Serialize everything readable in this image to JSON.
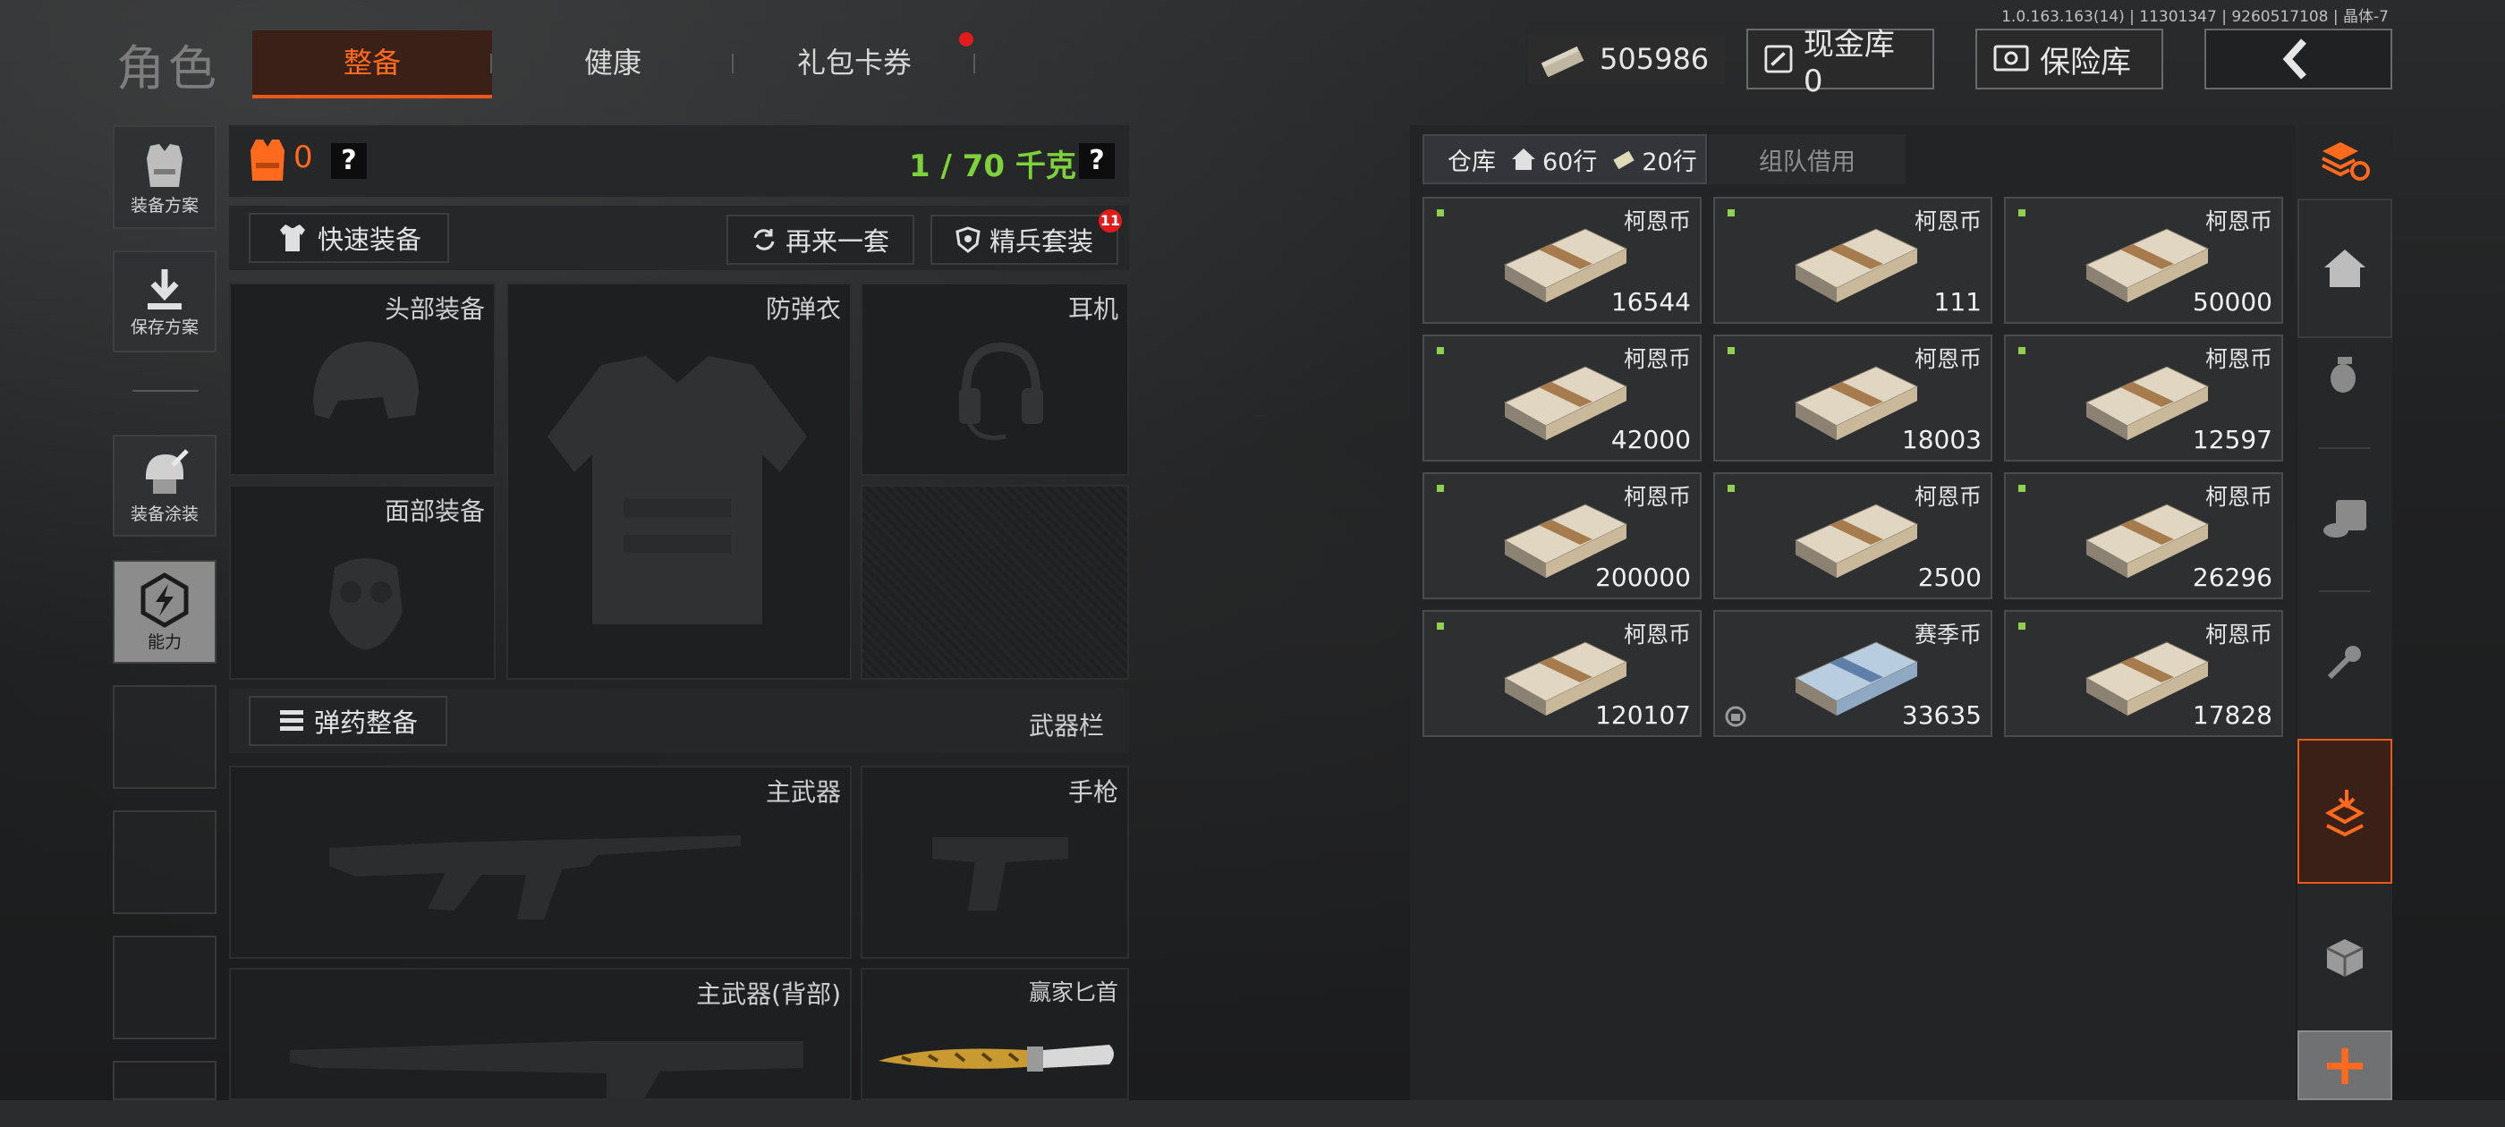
{
  "version": "1.0.163.163(14) | 11301347 | 9260517108 | 晶体-7",
  "header": {
    "title": "角色",
    "tabs": [
      {
        "label": "整备",
        "active": true
      },
      {
        "label": "健康",
        "active": false
      },
      {
        "label": "礼包卡券",
        "active": false,
        "badge_dot": true
      }
    ],
    "money": "505986",
    "cash_vault": "现金库 0",
    "safe_box": "保险库"
  },
  "left_tools": [
    {
      "label": "装备方案",
      "icon": "vest-plan-icon"
    },
    {
      "label": "保存方案",
      "icon": "download-icon"
    },
    {
      "label": "装备涂装",
      "icon": "helmet-paint-icon"
    },
    {
      "label": "能力",
      "icon": "lightning-icon",
      "active": true
    }
  ],
  "gear": {
    "armor_count": "0",
    "weight": "1 / 70 千克",
    "question": "?",
    "quick_equip": "快速装备",
    "another_set": "再来一套",
    "elite_set": "精兵套装",
    "elite_badge": "11",
    "slots": {
      "head": "头部装备",
      "vest": "防弹衣",
      "headset": "耳机",
      "face": "面部装备",
      "primary": "主武器",
      "pistol": "手枪",
      "primary_back": "主武器(背部)",
      "knife": "赢家匕首"
    },
    "ammo_btn": "弹药整备",
    "weapon_bar": "武器栏"
  },
  "warehouse": {
    "tab_label": "仓库",
    "rows_home": "60行",
    "rows_ticket": "20行",
    "team_borrow": "组队借用",
    "items": [
      {
        "name": "柯恩币",
        "qty": "16544",
        "kind": "koen"
      },
      {
        "name": "柯恩币",
        "qty": "111",
        "kind": "koen"
      },
      {
        "name": "柯恩币",
        "qty": "50000",
        "kind": "koen"
      },
      {
        "name": "柯恩币",
        "qty": "42000",
        "kind": "koen"
      },
      {
        "name": "柯恩币",
        "qty": "18003",
        "kind": "koen"
      },
      {
        "name": "柯恩币",
        "qty": "12597",
        "kind": "koen"
      },
      {
        "name": "柯恩币",
        "qty": "200000",
        "kind": "koen"
      },
      {
        "name": "柯恩币",
        "qty": "2500",
        "kind": "koen"
      },
      {
        "name": "柯恩币",
        "qty": "26296",
        "kind": "koen"
      },
      {
        "name": "柯恩币",
        "qty": "120107",
        "kind": "koen"
      },
      {
        "name": "赛季币",
        "qty": "33635",
        "kind": "season"
      },
      {
        "name": "柯恩币",
        "qty": "17828",
        "kind": "koen"
      }
    ]
  },
  "right_rail": {
    "add": "+"
  },
  "colors": {
    "accent": "#ff6a1c",
    "green": "#7fd13b",
    "badge": "#e21c1c"
  }
}
